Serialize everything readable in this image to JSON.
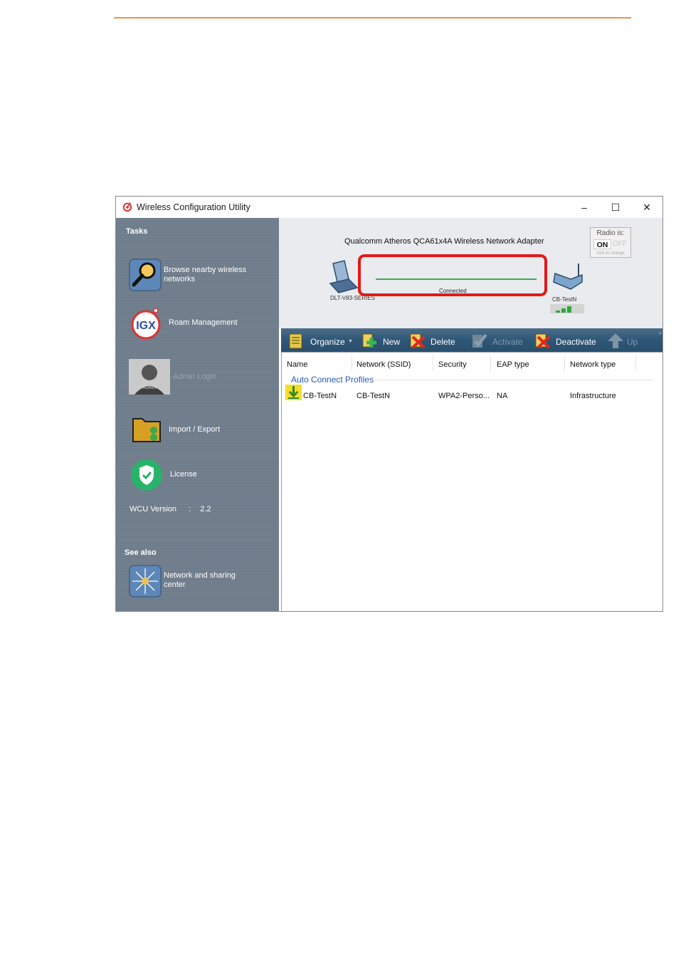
{
  "window": {
    "title": "Wireless Configuration Utility",
    "controls": {
      "minimize": "–",
      "maximize": "☐",
      "close": "✕"
    }
  },
  "sidebar": {
    "tasks_heading": "Tasks",
    "items": [
      {
        "label": "Browse nearby wireless networks",
        "icon": "magnifier-icon"
      },
      {
        "label": "Roam Management",
        "icon": "igx-icon"
      },
      {
        "label": "Admin Login",
        "icon": "admin-avatar-icon",
        "disabled": true
      },
      {
        "label": "Import / Export",
        "icon": "folder-icon"
      },
      {
        "label": "License",
        "icon": "shield-check-icon"
      }
    ],
    "version": {
      "label": "WCU Version",
      "separator": ":",
      "value": "2.2"
    },
    "see_also_heading": "See also",
    "see_also_items": [
      {
        "label": "Network and sharing center",
        "icon": "network-star-icon"
      }
    ]
  },
  "status_panel": {
    "adapter": "Qualcomm Atheros QCA61x4A Wireless Network Adapter",
    "radio": {
      "title": "Radio is:",
      "on": "ON",
      "off": "OFF",
      "hint": "click to change"
    },
    "laptop_label": "DLT-V83-SERIES",
    "connection_status": "Connected",
    "router_label": "CB-TestN",
    "signal_bars": 3,
    "colors": {
      "highlight": "#e31919",
      "link": "#3eaa52"
    }
  },
  "toolbar": {
    "buttons": [
      {
        "label": "Organize",
        "icon": "organize-icon",
        "enabled": true,
        "dropdown": "▼"
      },
      {
        "label": "New",
        "icon": "plus-icon",
        "enabled": true
      },
      {
        "label": "Delete",
        "icon": "delete-icon",
        "enabled": true
      },
      {
        "label": "Activate",
        "icon": "activate-icon",
        "enabled": false
      },
      {
        "label": "Deactivate",
        "icon": "deactivate-icon",
        "enabled": true
      },
      {
        "label": "Up",
        "icon": "up-arrow-icon",
        "enabled": false
      }
    ],
    "overflow": "»"
  },
  "profiles": {
    "columns": [
      "Name",
      "Network (SSID)",
      "Security",
      "EAP type",
      "Network type"
    ],
    "group": "Auto Connect Profiles",
    "rows": [
      {
        "name": "CB-TestN",
        "ssid": "CB-TestN",
        "security": "WPA2-Perso...",
        "eap": "NA",
        "network_type": "Infrastructure"
      }
    ]
  }
}
